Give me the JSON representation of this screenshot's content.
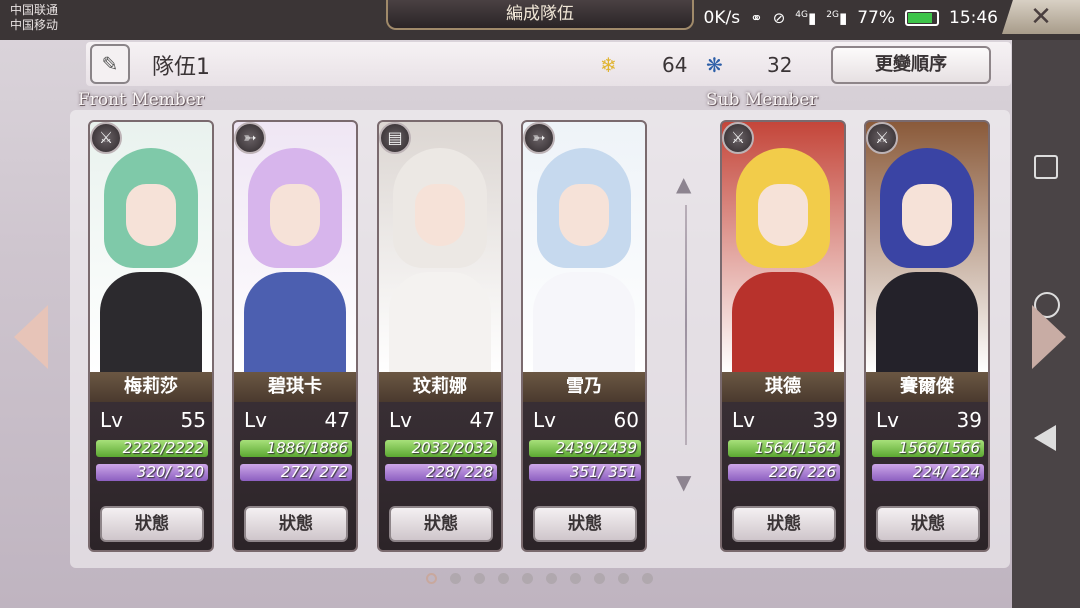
{
  "status_bar": {
    "carrier_1": "中国联通",
    "carrier_2": "中国移动",
    "speed": "0K/s",
    "signal_1": "4G",
    "signal_2": "2G",
    "battery": "77%",
    "time": "15:46"
  },
  "header": {
    "title": "編成隊伍"
  },
  "team": {
    "name": "隊伍1",
    "resource_1": {
      "icon": "feather-icon",
      "value": "64"
    },
    "resource_2": {
      "icon": "swirl-icon",
      "value": "32"
    },
    "reorder_label": "更變順序"
  },
  "sections": {
    "front": "Front Member",
    "sub": "Sub Member"
  },
  "members": [
    {
      "name": "梅莉莎",
      "lv_label": "Lv",
      "lv": "55",
      "hp": "2222/2222",
      "sp": "320/  320",
      "status_label": "狀態",
      "type_icon": "sword-icon",
      "hair": "#7fc9a9",
      "bg": "#e9f2ee",
      "body": "#2c2a2e"
    },
    {
      "name": "碧琪卡",
      "lv_label": "Lv",
      "lv": "47",
      "hp": "1886/1886",
      "sp": "272/  272",
      "status_label": "狀態",
      "type_icon": "bow-icon",
      "hair": "#d7b5ec",
      "bg": "#efe6f4",
      "body": "#4c5fb0"
    },
    {
      "name": "玟莉娜",
      "lv_label": "Lv",
      "lv": "47",
      "hp": "2032/2032",
      "sp": "228/  228",
      "status_label": "狀態",
      "type_icon": "book-icon",
      "hair": "#ece8e4",
      "bg": "#dcd6d2",
      "body": "#f4f2f0"
    },
    {
      "name": "雪乃",
      "lv_label": "Lv",
      "lv": "60",
      "hp": "2439/2439",
      "sp": "351/  351",
      "status_label": "狀態",
      "type_icon": "bow-icon",
      "hair": "#c6d9ee",
      "bg": "#eef3f8",
      "body": "#f6f6fa"
    },
    {
      "name": "琪德",
      "lv_label": "Lv",
      "lv": "39",
      "hp": "1564/1564",
      "sp": "226/  226",
      "status_label": "狀態",
      "type_icon": "sword-icon",
      "hair": "#f2cc4a",
      "bg": "#c4463a",
      "body": "#b8322c"
    },
    {
      "name": "賽爾傑",
      "lv_label": "Lv",
      "lv": "39",
      "hp": "1566/1566",
      "sp": "224/  224",
      "status_label": "狀態",
      "type_icon": "sword-icon",
      "hair": "#3a44a4",
      "bg": "#8a5a3a",
      "body": "#24222a"
    }
  ],
  "page_count": 10,
  "page_active": 0
}
